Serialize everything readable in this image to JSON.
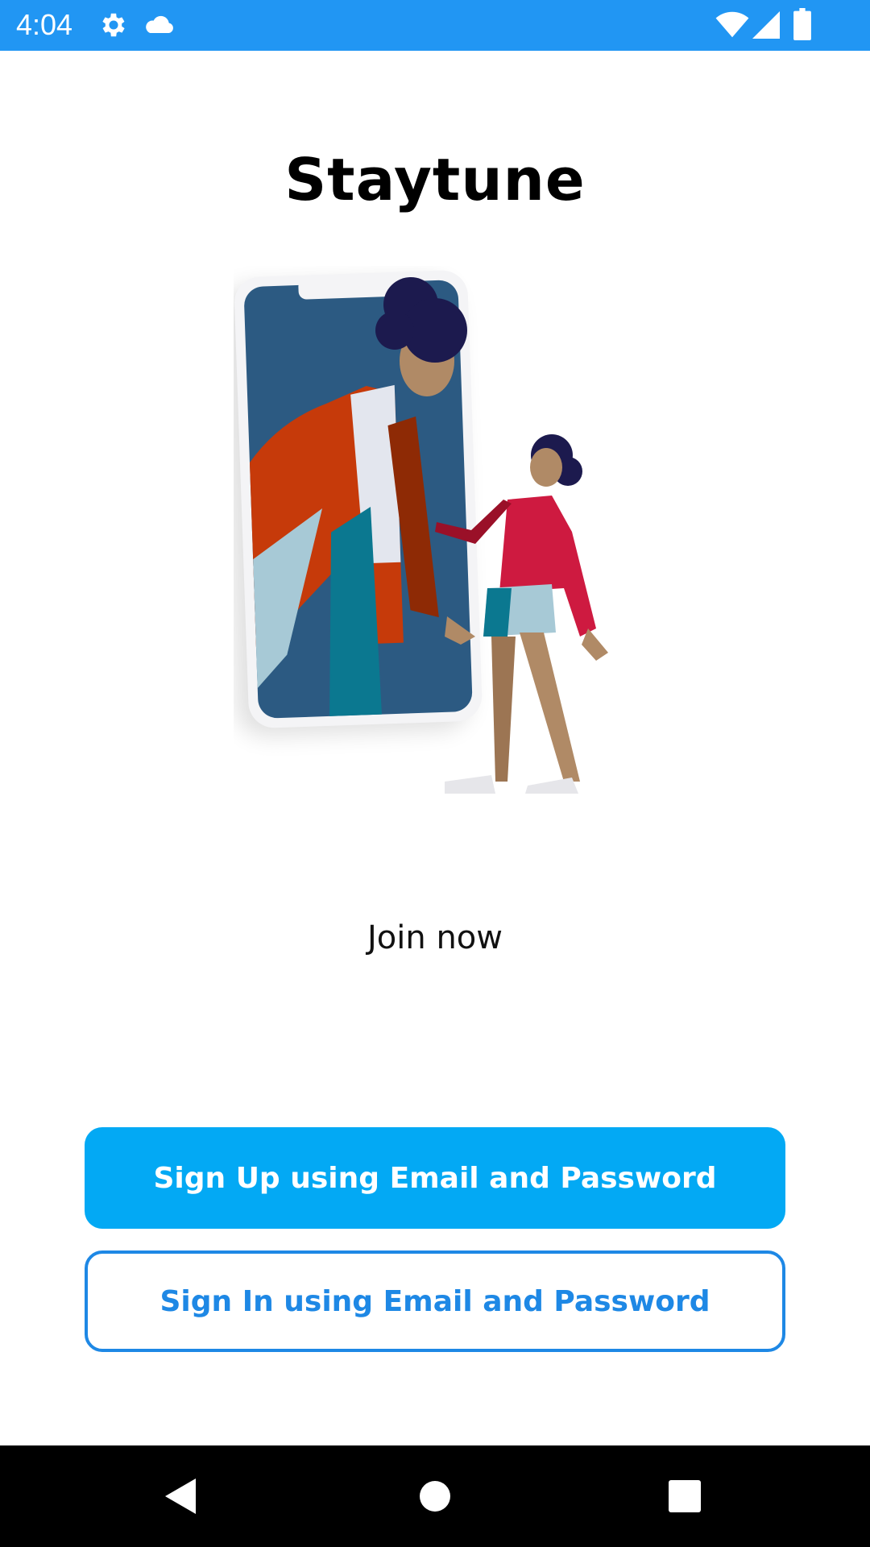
{
  "status_bar": {
    "time": "4:04",
    "icons": [
      "gear-icon",
      "cloud-icon",
      "wifi-icon",
      "signal-icon",
      "battery-icon"
    ],
    "background": "#2196F3"
  },
  "app": {
    "title": "Staytune",
    "tagline": "Join now"
  },
  "buttons": {
    "sign_up": "Sign Up using Email and Password",
    "sign_in": "Sign In using Email and Password"
  },
  "colors": {
    "primary_button": "#03A9F4",
    "outline_button": "#1E88E5"
  },
  "nav_bar": {
    "icons": [
      "back-icon",
      "home-icon",
      "recents-icon"
    ]
  }
}
